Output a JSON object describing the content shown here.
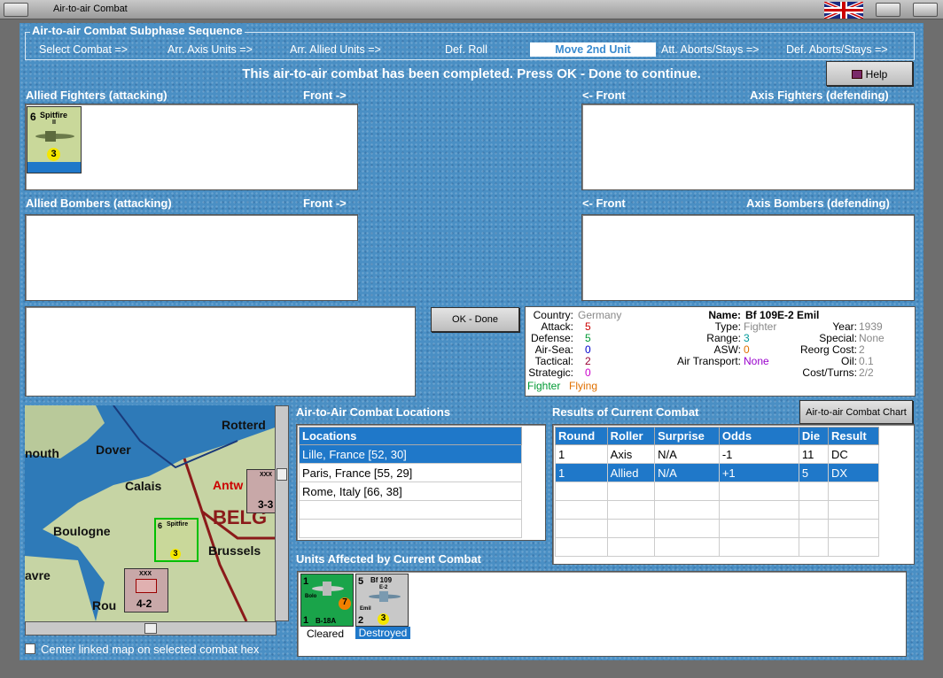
{
  "window": {
    "title": "Air-to-air Combat"
  },
  "sequence": {
    "title": "Air-to-air Combat Subphase Sequence",
    "steps": [
      "Select Combat =>",
      "Arr. Axis Units =>",
      "Arr. Allied Units =>",
      "Def. Roll",
      "Move 2nd Unit",
      "Att. Aborts/Stays =>",
      "Def. Aborts/Stays =>"
    ],
    "active_index": 4
  },
  "status_message": "This air-to-air combat has been completed.  Press OK - Done to continue.",
  "help_label": "Help",
  "panels": {
    "allied_fighters": "Allied Fighters (attacking)",
    "axis_fighters": "Axis Fighters (defending)",
    "allied_bombers": "Allied Bombers (attacking)",
    "axis_bombers": "Axis Bombers (defending)",
    "front_right": "Front ->",
    "front_left": "<- Front"
  },
  "spitfire_counter": {
    "name": "Spitfire",
    "sub": "II",
    "left": "6",
    "bottom": "3"
  },
  "ok_label": "OK - Done",
  "unit_stats": {
    "country_l": "Country:",
    "country": "Germany",
    "attack_l": "Attack:",
    "attack": "5",
    "defense_l": "Defense:",
    "defense": "5",
    "airsea_l": "Air-Sea:",
    "airsea": "0",
    "tactical_l": "Tactical:",
    "tactical": "2",
    "strategic_l": "Strategic:",
    "strategic": "0",
    "fighter": "Fighter",
    "flying": "Flying",
    "name_l": "Name:",
    "name": "Bf 109E-2 Emil",
    "type_l": "Type:",
    "type": "Fighter",
    "range_l": "Range:",
    "range": "3",
    "asw_l": "ASW:",
    "asw": "0",
    "airtransport_l": "Air Transport:",
    "airtransport": "None",
    "year_l": "Year:",
    "year": "1939",
    "special_l": "Special:",
    "special": "None",
    "reorg_l": "Reorg Cost:",
    "reorg": "2",
    "oil_l": "Oil:",
    "oil": "0.1",
    "costturns_l": "Cost/Turns:",
    "costturns": "2/2"
  },
  "locations": {
    "title": "Air-to-Air Combat Locations",
    "header": "Locations",
    "items": [
      "Lille, France [52, 30]",
      "Paris, France [55, 29]",
      "Rome, Italy [66, 38]"
    ]
  },
  "results": {
    "title": "Results of Current Combat",
    "chart_button": "Air-to-air Combat Chart",
    "headers": [
      "Round",
      "Roller",
      "Surprise",
      "Odds",
      "Die",
      "Result"
    ],
    "rows": [
      [
        "1",
        "Axis",
        "N/A",
        "-1",
        "11",
        "DC"
      ],
      [
        "1",
        "Allied",
        "N/A",
        "+1",
        "5",
        "DX"
      ]
    ]
  },
  "affected": {
    "title": "Units Affected by Current Combat",
    "units": [
      {
        "top_left": "1",
        "name": "B-18A",
        "sub": "Bolo",
        "bottom_left": "1",
        "range": "7",
        "status": "Cleared"
      },
      {
        "top_left": "5",
        "name": "Bf 109",
        "sub": "E-2",
        "sub2": "Emil",
        "bottom_left": "2",
        "range": "3",
        "status": "Destroyed"
      }
    ]
  },
  "map": {
    "labels": [
      "Dover",
      "Calais",
      "Rotterd",
      "nouth",
      "Boulogne",
      "Antw",
      "BELG",
      "Brussels",
      "avre",
      "Rou"
    ],
    "unit_spitfire": {
      "left": "6",
      "name": "Spitfire",
      "sub": "II",
      "bottom": "3"
    },
    "unit_inf": {
      "top": "XXX",
      "bottom": "4-2"
    },
    "unit_right": {
      "top": "XXX",
      "bottom": "3-3"
    }
  },
  "checkbox_label": "Center linked map on selected combat hex",
  "colors": {
    "accent": "#1f78c9",
    "red": "#cc0000",
    "green": "#009933",
    "orange": "#e07000",
    "purple": "#9900cc",
    "grey": "#888888"
  }
}
